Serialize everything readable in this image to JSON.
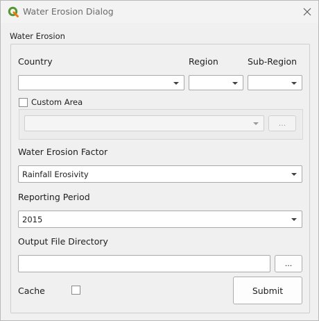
{
  "window": {
    "title": "Water Erosion Dialog",
    "icon": "qgis-logo-icon",
    "close_icon": "close-icon"
  },
  "group": {
    "title": "Water Erosion"
  },
  "country": {
    "label": "Country",
    "value": ""
  },
  "region": {
    "label": "Region",
    "value": ""
  },
  "sub_region": {
    "label": "Sub-Region",
    "value": ""
  },
  "custom_area": {
    "label": "Custom Area",
    "checked": false,
    "layer_value": "",
    "browse_label": "..."
  },
  "erosion_factor": {
    "label": "Water Erosion Factor",
    "value": "Rainfall Erosivity"
  },
  "reporting_period": {
    "label": "Reporting Period",
    "value": "2015"
  },
  "output_dir": {
    "label": "Output File Directory",
    "value": "",
    "browse_label": "..."
  },
  "cache": {
    "label": "Cache",
    "checked": false
  },
  "submit": {
    "label": "Submit"
  },
  "colors": {
    "qgis_green": "#589632",
    "qgis_yellow": "#ee7913"
  }
}
